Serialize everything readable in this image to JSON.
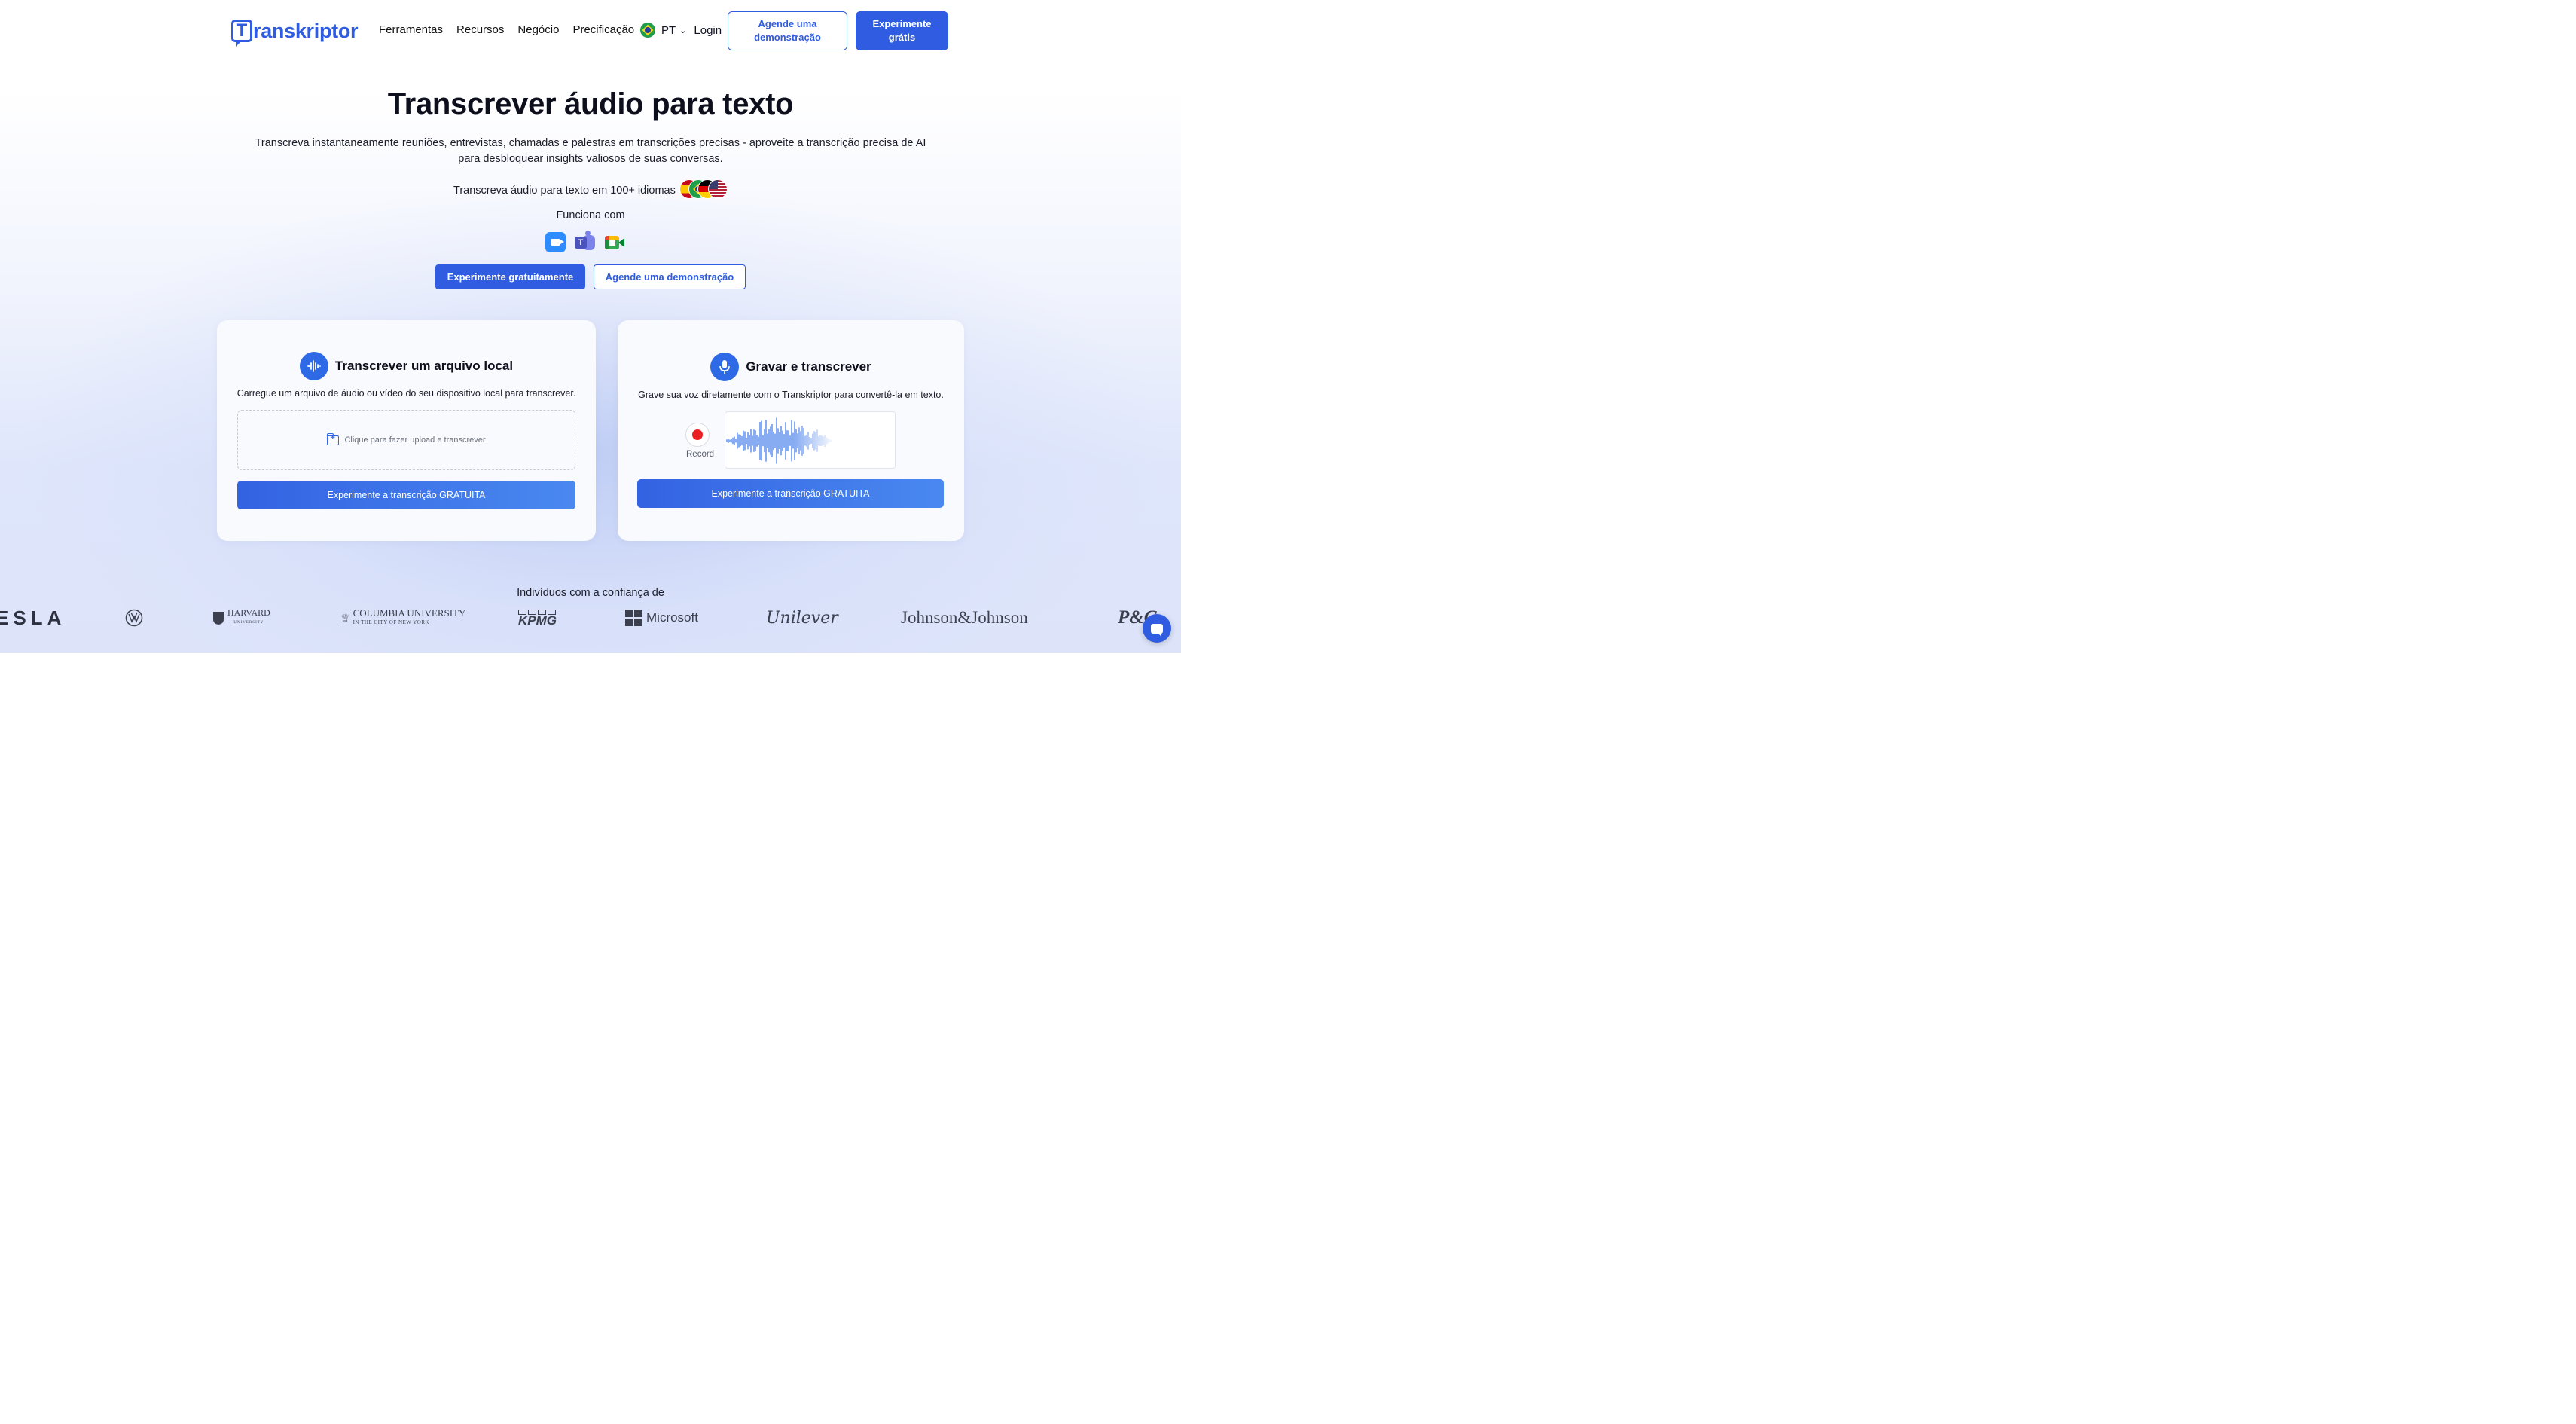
{
  "nav": {
    "logo_text": "ranskriptor",
    "logo_letter": "T",
    "links": [
      "Ferramentas",
      "Recursos",
      "Negócio",
      "Precificação"
    ],
    "language": "PT",
    "login": "Login",
    "demo_button": "Agende uma demonstração",
    "try_button": "Experimente grátis"
  },
  "hero": {
    "title": "Transcrever áudio para texto",
    "subtitle": "Transcreva instantaneamente reuniões, entrevistas, chamadas e palestras em transcrições precisas - aproveite a transcrição precisa de AI para desbloquear insights valiosos de suas conversas.",
    "languages_line": "Transcreva áudio para texto em 100+ idiomas",
    "works_with": "Funciona com",
    "apps": [
      "zoom-icon",
      "teams-icon",
      "google-meet-icon"
    ],
    "cta_primary": "Experimente gratuitamente",
    "cta_secondary": "Agende uma demonstração"
  },
  "upload_card": {
    "title": "Transcrever um arquivo local",
    "description": "Carregue um arquivo de áudio ou vídeo do seu dispositivo local para transcrever.",
    "dropzone_text": "Clique para fazer upload e transcrever",
    "button": "Experimente a transcrição GRATUITA"
  },
  "record_card": {
    "title": "Gravar e transcrever",
    "description": "Grave sua voz diretamente com o Transkriptor para convertê-la em texto.",
    "record_label": "Record",
    "button": "Experimente a transcrição GRATUITA"
  },
  "trusted": {
    "heading": "Indivíduos com a confiança de",
    "logos": [
      "TESLA",
      "Volkswagen",
      "Harvard University",
      "Columbia University in the City of New York",
      "KPMG",
      "Microsoft",
      "Unilever",
      "Johnson&Johnson",
      "P&G"
    ]
  },
  "colors": {
    "brand": "#2f5ce0",
    "record_red": "#ea1f1f"
  }
}
